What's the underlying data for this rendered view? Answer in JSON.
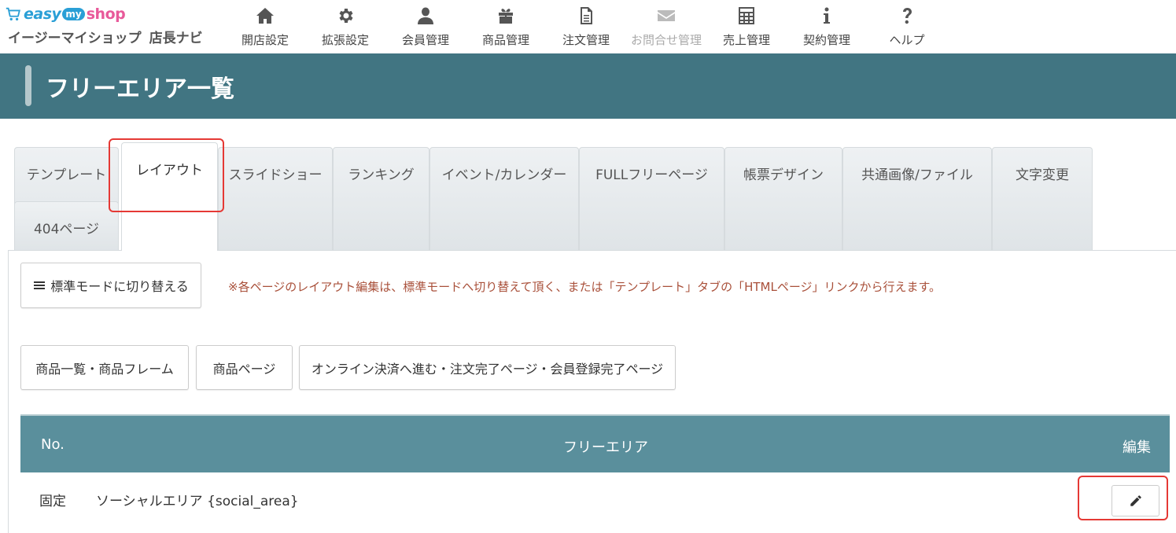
{
  "logo": {
    "easy": "easy",
    "my": "my",
    "shop": "shop",
    "subtitle": "イージーマイショップ",
    "navi": "店長ナビ"
  },
  "nav": [
    {
      "label": "開店設定",
      "icon": "home-icon",
      "disabled": false
    },
    {
      "label": "拡張設定",
      "icon": "gear-icon",
      "disabled": false
    },
    {
      "label": "会員管理",
      "icon": "user-icon",
      "disabled": false
    },
    {
      "label": "商品管理",
      "icon": "gift-icon",
      "disabled": false
    },
    {
      "label": "注文管理",
      "icon": "document-icon",
      "disabled": false
    },
    {
      "label": "お問合せ管理",
      "icon": "envelope-icon",
      "disabled": true
    },
    {
      "label": "売上管理",
      "icon": "calculator-icon",
      "disabled": false
    },
    {
      "label": "契約管理",
      "icon": "info-icon",
      "disabled": false
    },
    {
      "label": "ヘルプ",
      "icon": "question-icon",
      "disabled": false
    }
  ],
  "page_title": "フリーエリア一覧",
  "tabs": [
    {
      "label": "テンプレート",
      "active": false
    },
    {
      "label": "レイアウト",
      "active": true
    },
    {
      "label": "スライドショー",
      "active": false
    },
    {
      "label": "ランキング",
      "active": false
    },
    {
      "label": "イベント/カレンダー",
      "active": false
    },
    {
      "label": "FULLフリーページ",
      "active": false
    },
    {
      "label": "帳票デザイン",
      "active": false
    },
    {
      "label": "共通画像/ファイル",
      "active": false
    },
    {
      "label": "文字変更",
      "active": false
    },
    {
      "label": "404ページ",
      "active": false
    }
  ],
  "standard_mode_button": "標準モードに切り替える",
  "notice": "※各ページのレイアウト編集は、標準モードへ切り替えて頂く、または「テンプレート」タブの「HTMLページ」リンクから行えます。",
  "page_buttons": [
    "商品一覧・商品フレーム",
    "商品ページ",
    "オンライン決済へ進む・注文完了ページ・会員登録完了ページ"
  ],
  "table": {
    "headers": {
      "no": "No.",
      "area": "フリーエリア",
      "edit": "編集"
    },
    "rows": [
      {
        "no": "固定",
        "area": "ソーシャルエリア {social_area}"
      }
    ]
  },
  "colors": {
    "header_bar": "#417582",
    "table_header": "#5a8f9c",
    "notice": "#a9503a",
    "highlight": "#e53935"
  }
}
